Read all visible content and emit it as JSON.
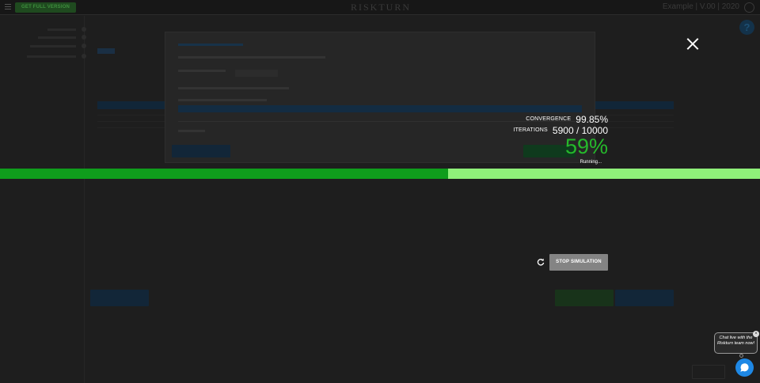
{
  "header": {
    "get_full_version": "GET FULL VERSION",
    "logo": "RISKTURN",
    "version": "Example | V.00 | 2020"
  },
  "help": {
    "label": "?"
  },
  "simulation": {
    "convergence_label": "Convergence",
    "convergence_value": "99.85%",
    "iterations_label": "Iterations",
    "iterations_value": "5900 / 10000",
    "percent": "59%",
    "progress_fraction": 0.59,
    "status": "Running...",
    "stop_button": "STOP SIMULATION"
  },
  "chat": {
    "bubble_text": "Chat live with the Riskturn team now!",
    "close": "×"
  },
  "colors": {
    "progress_done": "#0f9d1c",
    "progress_remaining": "#8ff07a",
    "percent_text": "#25b82b",
    "stop_button": "#848484",
    "chat_launcher": "#1e88e5"
  },
  "icons": {
    "close": "close-icon",
    "refresh": "refresh-icon",
    "chat": "chat-icon",
    "help": "help-icon",
    "user": "user-icon",
    "menu": "menu-icon"
  }
}
